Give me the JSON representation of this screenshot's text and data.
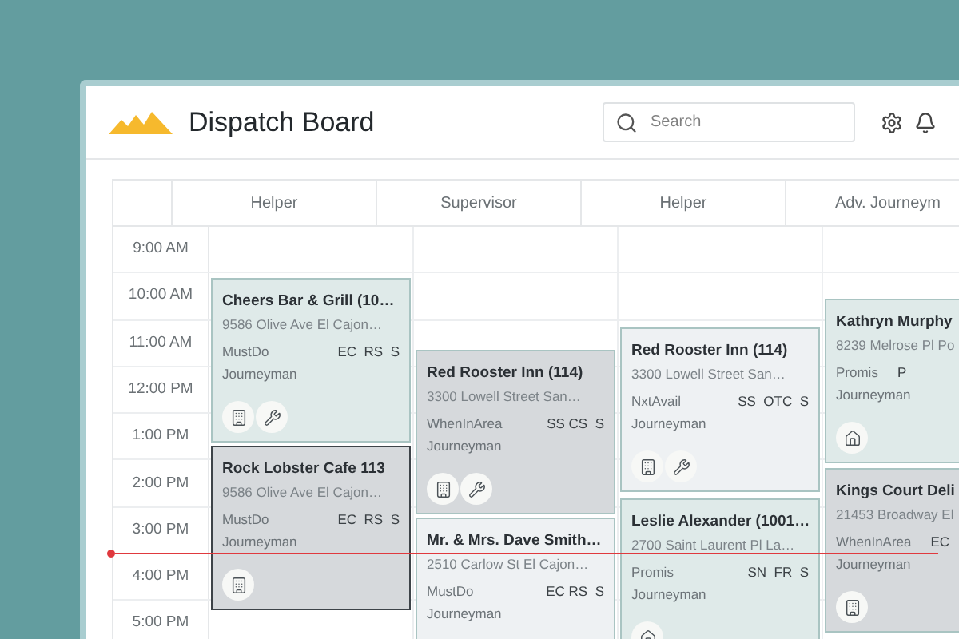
{
  "app": {
    "title": "Dispatch Board",
    "search": {
      "placeholder": "Search"
    }
  },
  "times": [
    "9:00 AM",
    "10:00 AM",
    "11:00 AM",
    "12:00 PM",
    "1:00 PM",
    "2:00 PM",
    "3:00 PM",
    "4:00 PM",
    "5:00 PM"
  ],
  "columns": [
    {
      "header": "Helper",
      "cards": [
        {
          "title": "Cheers Bar & Grill (10…",
          "address": "9586 Olive Ave El Cajon…",
          "source": "MustDo",
          "tags": "EC  RS  S",
          "role": "Journeyman",
          "color": "#dfeae9",
          "selected": false,
          "kind": "commercial",
          "repair": true
        },
        {
          "title": "Rock Lobster Cafe 113",
          "address": "9586 Olive Ave El Cajon…",
          "source": "MustDo",
          "tags": "EC  RS  S",
          "role": "Journeyman",
          "color": "#d6d9dc",
          "selected": true,
          "kind": "commercial",
          "repair": false
        }
      ]
    },
    {
      "header": "Supervisor",
      "cards": [
        {
          "title": "Red Rooster Inn (114)",
          "address": "3300 Lowell Street San…",
          "source": "WhenInArea",
          "tags": "SS CS  S",
          "role": "Journeyman",
          "color": "#d6d9dc",
          "selected": false,
          "kind": "commercial",
          "repair": true
        },
        {
          "title": "Mr. & Mrs. Dave Smith…",
          "address": "2510 Carlow St El Cajon…",
          "source": "MustDo",
          "tags": "EC RS  S",
          "role": "Journeyman",
          "color": "#eef1f3",
          "selected": false
        }
      ]
    },
    {
      "header": "Helper",
      "cards": [
        {
          "title": "Red Rooster Inn (114)",
          "address": "3300 Lowell Street San…",
          "source": "NxtAvail",
          "tags": "SS  OTC  S",
          "role": "Journeyman",
          "color": "#eef1f3",
          "selected": false,
          "kind": "commercial",
          "repair": true
        },
        {
          "title": "Leslie Alexander (1001…",
          "address": "2700 Saint Laurent Pl La…",
          "source": "Promis",
          "tags": "SN  FR  S",
          "role": "Journeyman",
          "color": "#dfeae9",
          "selected": false,
          "kind": "residential",
          "repair": false
        }
      ]
    },
    {
      "header": "Adv. Journeym",
      "cards": [
        {
          "title": "Kathryn Murphy",
          "address": "8239 Melrose Pl Po",
          "source": "Promis",
          "tags": "P",
          "role": "Journeyman",
          "color": "#dfeae9",
          "selected": false,
          "kind": "residential",
          "repair": false
        },
        {
          "title": "Kings Court Deli",
          "address": "21453 Broadway El",
          "source": "WhenInArea",
          "tags": "EC",
          "role": "Journeyman",
          "color": "#d6d9dc",
          "selected": false,
          "kind": "commercial",
          "repair": false
        }
      ]
    }
  ]
}
